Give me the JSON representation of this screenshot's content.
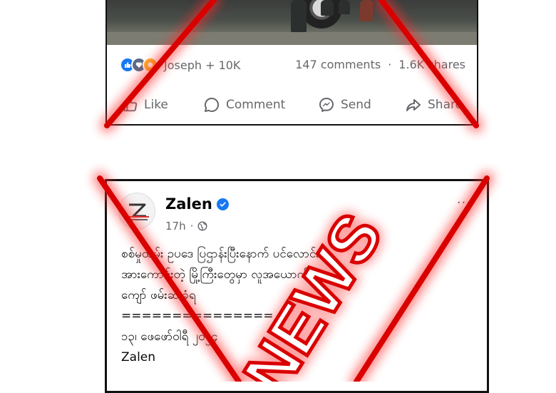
{
  "post1": {
    "reaction_label": "Joseph + 10K",
    "comments": "147 comments",
    "separator": "·",
    "shares": "1.6K shares",
    "actions": {
      "like": "Like",
      "comment": "Comment",
      "send": "Send",
      "share": "Share"
    }
  },
  "post2": {
    "author": "Zalen",
    "time": "17h",
    "dot": "·",
    "more": "···",
    "lines": [
      "စစ်မှုထမ်း ဥပဒေ ပြဌာန်းပြီးနောက် ပင်လောင်းစိ",
      "အားကောင်းတဲ့ မြို့ကြီးတွေမှာ လူအယောက် ၁၀၀",
      "ကျော် ဖမ်းဆီးခံရ",
      "===============",
      "၁၃၊ ဖေဖော်ဝါရီ ၂၀၂၄",
      "Zalen"
    ]
  },
  "overlay": {
    "stamp": "NEWS",
    "color": "#d90000"
  }
}
